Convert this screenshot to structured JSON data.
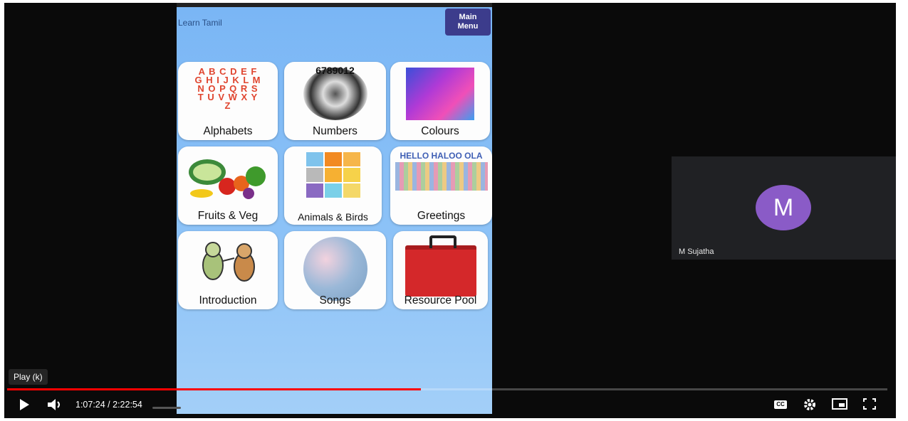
{
  "app": {
    "title": "Learn Tamil",
    "main_menu_label": "Main Menu"
  },
  "tiles": [
    {
      "label": "Alphabets",
      "icon": "alphabet-blocks-icon",
      "art_text": "A B C D E F G H I J K L M N O P Q R S T U V W X Y Z"
    },
    {
      "label": "Numbers",
      "icon": "number-spiral-icon",
      "art_text": "6789012"
    },
    {
      "label": "Colours",
      "icon": "color-gradient-icon"
    },
    {
      "label": "Fruits & Veg",
      "icon": "fruits-vegetables-icon"
    },
    {
      "label": "Animals & Birds",
      "icon": "animal-faces-grid-icon"
    },
    {
      "label": "Greetings",
      "icon": "greetings-wordcloud-icon",
      "art_text": "HELLO HALOO OLA"
    },
    {
      "label": "Introduction",
      "icon": "cartoon-bugs-icon"
    },
    {
      "label": "Songs",
      "icon": "word-globe-icon"
    },
    {
      "label": "Resource Pool",
      "icon": "red-toolbox-icon"
    }
  ],
  "participant": {
    "initial": "M",
    "name": "M Sujatha",
    "avatar_color": "#8a5bc7"
  },
  "player": {
    "tooltip": "Play (k)",
    "time": "1:07:24 / 2:22:54",
    "progress_fraction": 0.47,
    "accent_color": "#ff0000",
    "cc_label": "CC"
  }
}
